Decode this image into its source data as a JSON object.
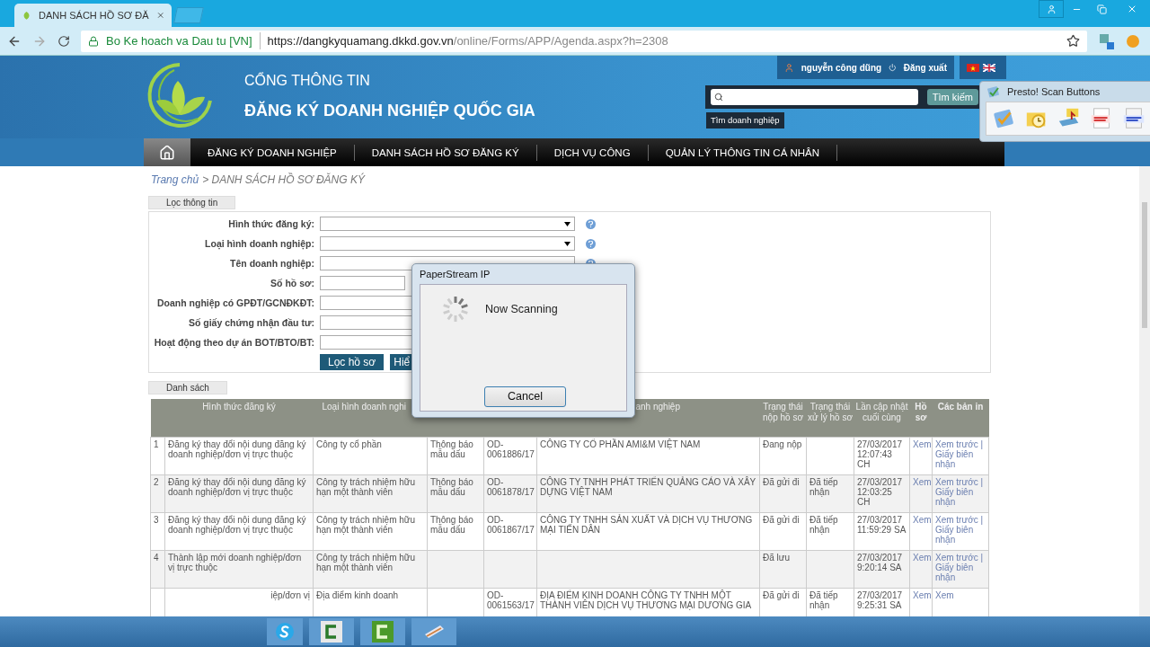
{
  "browser": {
    "tab_title": "DANH SÁCH HỒ SƠ ĐĂ",
    "site_name": "Bo Ke hoach va Dau tu [VN]",
    "url_host": "https://dangkyquamang.dkkd.gov.vn",
    "url_path": "/online/Forms/APP/Agenda.aspx?h=2308"
  },
  "site": {
    "title_small": "CỔNG THÔNG TIN",
    "title": "ĐĂNG KÝ DOANH NGHIỆP QUỐC GIA",
    "user": "nguyễn công dũng",
    "logout": "Đăng xuất",
    "search_button": "Tìm kiếm",
    "search_tooltip": "Tìm doanh nghiệp"
  },
  "nav": [
    "ĐĂNG KÝ DOANH NGHIỆP",
    "DANH SÁCH HỒ SƠ ĐĂNG KÝ",
    "DỊCH VỤ CÔNG",
    "QUẢN LÝ THÔNG TIN CÁ NHÂN"
  ],
  "breadcrumb": {
    "home": "Trang chủ",
    "current": "> DANH SÁCH HỒ SƠ ĐĂNG KÝ"
  },
  "filter": {
    "legend": "Lọc thông tin",
    "fields": [
      {
        "label": "Hình thức đăng ký:",
        "kind": "select",
        "help": true
      },
      {
        "label": "Loại hình doanh nghiệp:",
        "kind": "select",
        "help": true
      },
      {
        "label": "Tên doanh nghiệp:",
        "kind": "text",
        "help": true
      },
      {
        "label": "Số hồ sơ:",
        "kind": "short",
        "help": false
      },
      {
        "label": "Doanh nghiệp có GPĐT/GCNĐKĐT:",
        "kind": "text",
        "help": false
      },
      {
        "label": "Số giấy chứng nhận đầu tư:",
        "kind": "text",
        "help": false
      },
      {
        "label": "Hoạt động theo dự án BOT/BTO/BT:",
        "kind": "text",
        "help": false
      }
    ],
    "buttons": [
      "Lọc hồ sơ",
      "Hiể"
    ]
  },
  "list": {
    "legend": "Danh sách",
    "columns": [
      null,
      "Hình thức đăng ký",
      "Loại hình doanh nghi",
      null,
      null,
      "anh nghiệp",
      "Trạng thái nộp hồ sơ",
      "Trạng thái xử lý hồ sơ",
      "Lần cập nhật cuối cùng",
      "Hồ sơ",
      "Các bản in"
    ],
    "rows": [
      [
        "1",
        "Đăng ký thay đổi nội dung đăng ký doanh nghiệp/đơn vị trực thuộc",
        "Công ty cổ phần",
        "Thông báo mẫu dấu",
        "OD-0061886/17",
        "CÔNG TY CỔ PHẦN AMI&M VIỆT NAM",
        "Đang nộp",
        null,
        "27/03/2017 12:07:43 CH",
        "Xem",
        "Xem trước | Giấy biên nhận"
      ],
      [
        "2",
        "Đăng ký thay đổi nội dung đăng ký doanh nghiệp/đơn vị trực thuộc",
        "Công ty trách nhiệm hữu hạn một thành viên",
        "Thông báo mẫu dấu",
        "OD-0061878/17",
        "CÔNG TY TNHH PHÁT TRIỂN QUẢNG CÁO VÀ XÂY DỰNG VIỆT NAM",
        "Đã gửi đi",
        "Đã tiếp nhận",
        "27/03/2017 12:03:25 CH",
        "Xem",
        "Xem trước | Giấy biên nhận"
      ],
      [
        "3",
        "Đăng ký thay đổi nội dung đăng ký doanh nghiệp/đơn vị trực thuộc",
        "Công ty trách nhiệm hữu hạn một thành viên",
        "Thông báo mẫu dấu",
        "OD-0061867/17",
        "CÔNG TY TNHH SẢN XUẤT VÀ DỊCH VỤ THƯƠNG MẠI TIẾN DÂN",
        "Đã gửi đi",
        "Đã tiếp nhận",
        "27/03/2017 11:59:29 SA",
        "Xem",
        "Xem trước | Giấy biên nhận"
      ],
      [
        "4",
        "Thành lập mới doanh nghiệp/đơn vị trực thuộc",
        "Công ty trách nhiệm hữu hạn một thành viên",
        null,
        null,
        null,
        "Đã lưu",
        null,
        "27/03/2017 9:20:14 SA",
        "Xem",
        "Xem trước | Giấy biên nhận"
      ],
      [
        null,
        "iệp/đơn vị",
        "Địa điểm kinh doanh",
        null,
        "OD-0061563/17",
        "ĐỊA ĐIỂM KINH DOANH CÔNG TY TNHH MỘT THÀNH VIÊN DỊCH VỤ THƯƠNG MẠI DƯƠNG GIA",
        "Đã gửi đi",
        "Đã tiếp nhận",
        "27/03/2017 9:25:31 SA",
        "Xem",
        "Xem"
      ]
    ]
  },
  "dialog": {
    "title": "PaperStream IP",
    "message": "Now Scanning",
    "button": "Cancel"
  },
  "presto": {
    "title": "Presto! Scan Buttons"
  }
}
